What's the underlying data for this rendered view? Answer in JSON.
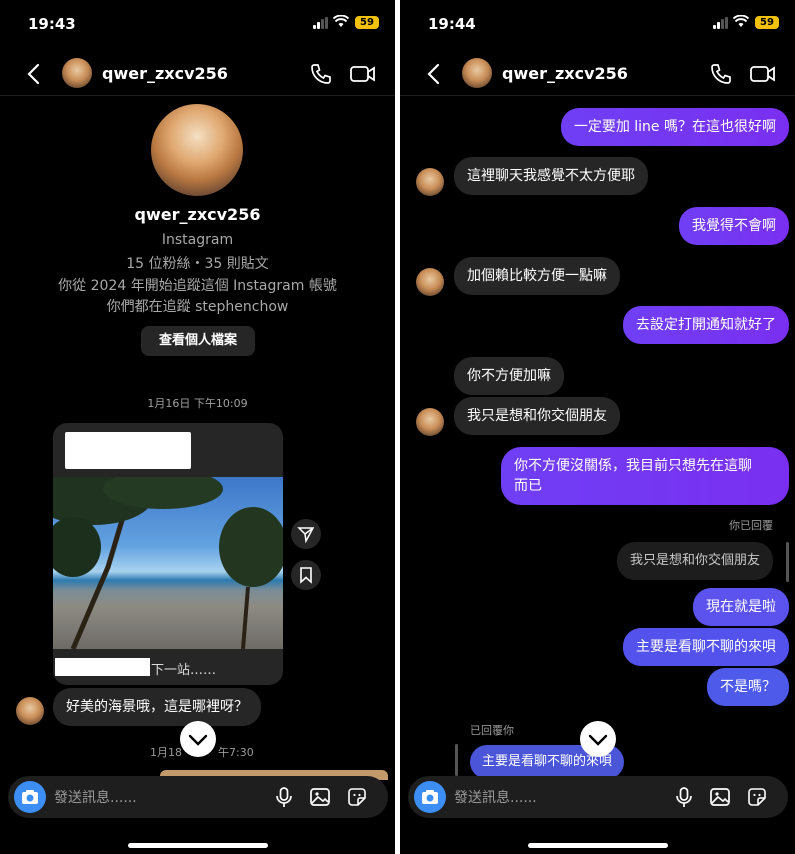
{
  "left": {
    "status": {
      "time": "19:43",
      "battery": "59"
    },
    "nav": {
      "username": "qwer_zxcv256"
    },
    "profile": {
      "name": "qwer_zxcv256",
      "platform": "Instagram",
      "stats": "15 位粉絲・35 則貼文",
      "follow_since": "你從 2024 年開始追蹤這個 Instagram 帳號",
      "mutual": "你們都在追蹤 stephenchow",
      "view_button": "查看個人檔案"
    },
    "stamp1": "1月16日 下午10:09",
    "post": {
      "caption_tail": "下一站……"
    },
    "reply": "好美的海景哦，這是哪裡呀？",
    "stamp2_left": "1月18",
    "stamp2_right": "午7:30",
    "composer_placeholder": "發送訊息......"
  },
  "right": {
    "status": {
      "time": "19:44",
      "battery": "59"
    },
    "nav": {
      "username": "qwer_zxcv256"
    },
    "messages": [
      {
        "from": "me",
        "text": "一定要加 line 嗎？在這也很好啊"
      },
      {
        "from": "them",
        "text": "這裡聊天我感覺不太方便耶"
      },
      {
        "from": "me",
        "text": "我覺得不會啊"
      },
      {
        "from": "them",
        "text": "加個賴比較方便一點嘛"
      },
      {
        "from": "me",
        "text": "去設定打開通知就好了"
      },
      {
        "from": "them",
        "text": "你不方便加嘛"
      },
      {
        "from": "them",
        "text": "我只是想和你交個朋友"
      },
      {
        "from": "me",
        "text_line1": "你不方便沒關係，我目前只想先在這聊",
        "text_line2": "而已"
      },
      {
        "label": "你已回覆"
      },
      {
        "from": "quote",
        "text": "我只是想和你交個朋友"
      },
      {
        "from": "me",
        "text": "現在就是啦"
      },
      {
        "from": "me",
        "text": "主要是看聊不聊的來唄"
      },
      {
        "from": "me",
        "text": "不是嗎？"
      },
      {
        "label": "已回覆你"
      },
      {
        "from": "quote",
        "text": "主要是看聊不聊的來唄"
      }
    ],
    "composer_placeholder": "發送訊息......"
  },
  "colors": {
    "sent": "#7a2ff0",
    "received": "#262626",
    "camera": "#3c8ef5",
    "battery": "#f2c20a"
  }
}
